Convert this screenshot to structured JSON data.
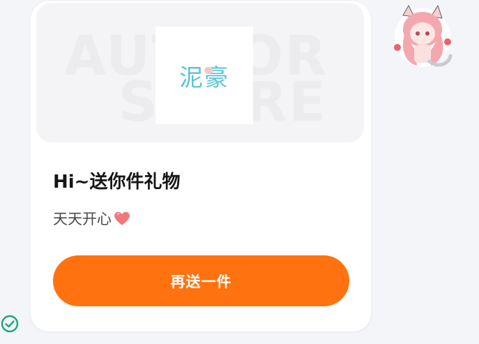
{
  "card": {
    "banner": {
      "watermark_line1": "AUTHOR",
      "watermark_line2": "STORE",
      "logo_text": "泥豪"
    },
    "title": "Hi~送你件礼物",
    "subtitle": "天天开心",
    "button_label": "再送一件"
  },
  "colors": {
    "accent": "#ff720f",
    "logo": "#5bc2d7",
    "heart": "#f0787a",
    "check": "#1aa57a"
  },
  "icons": {
    "heart": "heart-icon",
    "sticker": "anime-girl-sticker",
    "check": "check-circle-icon"
  }
}
